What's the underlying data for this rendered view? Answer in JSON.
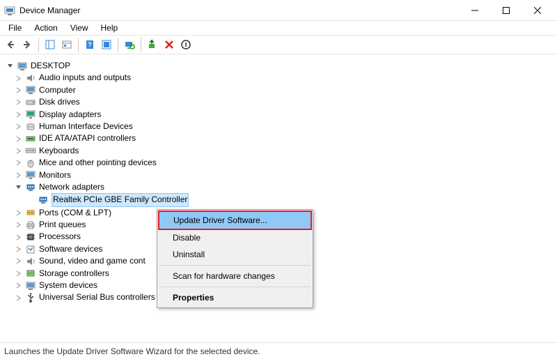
{
  "window": {
    "title": "Device Manager"
  },
  "menu": {
    "file": "File",
    "action": "Action",
    "view": "View",
    "help": "Help"
  },
  "tree": {
    "root": "DESKTOP",
    "items": [
      "Audio inputs and outputs",
      "Computer",
      "Disk drives",
      "Display adapters",
      "Human Interface Devices",
      "IDE ATA/ATAPI controllers",
      "Keyboards",
      "Mice and other pointing devices",
      "Monitors",
      "Network adapters",
      "Ports (COM & LPT)",
      "Print queues",
      "Processors",
      "Software devices",
      "Sound, video and game cont",
      "Storage controllers",
      "System devices",
      "Universal Serial Bus controllers"
    ],
    "selected_child": "Realtek PCIe GBE Family Controller"
  },
  "context_menu": {
    "update": "Update Driver Software...",
    "disable": "Disable",
    "uninstall": "Uninstall",
    "scan": "Scan for hardware changes",
    "properties": "Properties"
  },
  "status": "Launches the Update Driver Software Wizard for the selected device."
}
